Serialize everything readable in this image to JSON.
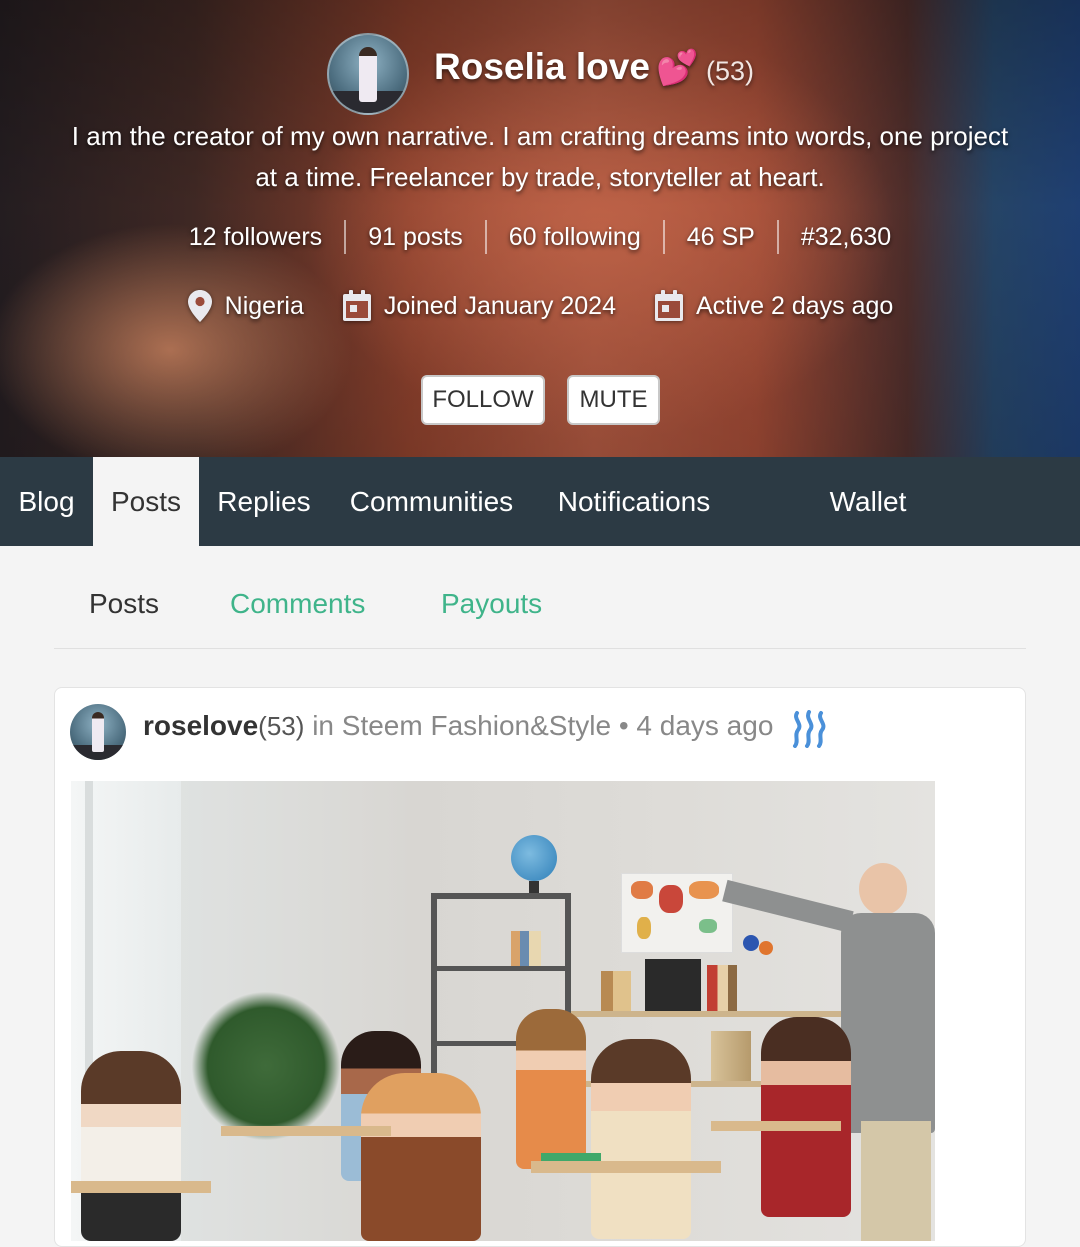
{
  "profile": {
    "name": "Roselia love",
    "name_emoji": "💕",
    "reputation": "(53)",
    "bio": "I am the creator of my own narrative. I am crafting dreams into words, one project at a time. Freelancer by trade, storyteller at heart.",
    "stats": {
      "followers": "12 followers",
      "posts": "91 posts",
      "following": "60 following",
      "sp": "46 SP",
      "rank": "#32,630"
    },
    "location": "Nigeria",
    "joined": "Joined January 2024",
    "active": "Active 2 days ago",
    "follow_label": "FOLLOW",
    "mute_label": "MUTE"
  },
  "tabs": [
    {
      "label": "Blog"
    },
    {
      "label": "Posts"
    },
    {
      "label": "Replies"
    },
    {
      "label": "Communities"
    },
    {
      "label": "Notifications"
    },
    {
      "label": "Wallet"
    }
  ],
  "subtabs": [
    {
      "label": "Posts"
    },
    {
      "label": "Comments"
    },
    {
      "label": "Payouts"
    }
  ],
  "post": {
    "author": "roselove",
    "author_rep": "(53)",
    "in_label": "in",
    "community": "Steem Fashion&Style",
    "separator": "•",
    "time": "4 days ago"
  },
  "colors": {
    "accent": "#3fb48a",
    "tabbar": "#2c3a44",
    "steem_blue": "#4a90d9"
  }
}
